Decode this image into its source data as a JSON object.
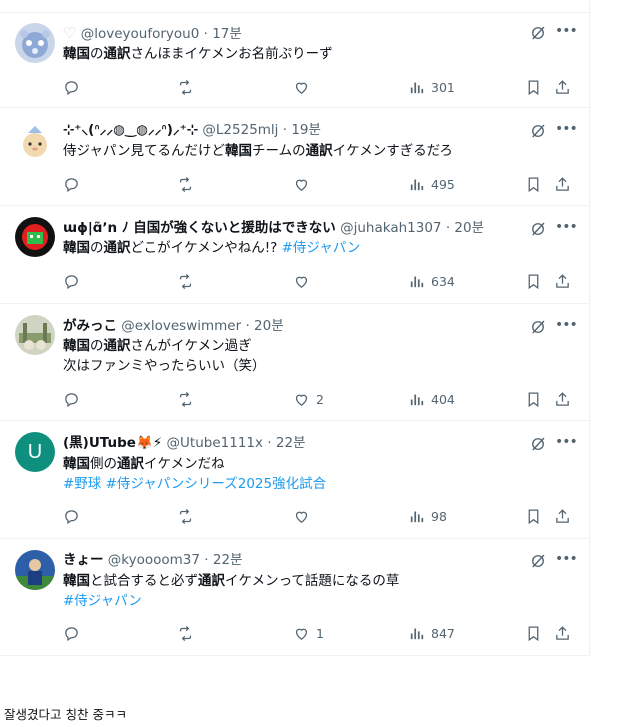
{
  "tweets": [
    {
      "heart_prefix": "♡",
      "display_name": "",
      "handle": "@loveyouforyou0",
      "time": "17분",
      "lines": [
        [
          {
            "t": "韓国",
            "b": true
          },
          {
            "t": "の"
          },
          {
            "t": "通訳",
            "b": true
          },
          {
            "t": "さんほまイケメンお名前ぷりーず"
          }
        ]
      ],
      "likes": "",
      "views": "301"
    },
    {
      "display_name": "⊹⁺⸜(ᐢ⸝⸝◍‿◍⸝⸝ᐢ)⸝⁺⊹",
      "handle": "@L2525mlj",
      "time": "19분",
      "lines": [
        [
          {
            "t": "侍ジャパン見てるんだけど"
          },
          {
            "t": "韓国",
            "b": true
          },
          {
            "t": "チームの"
          },
          {
            "t": "通訳",
            "b": true
          },
          {
            "t": "イケメンすぎるだろ"
          }
        ]
      ],
      "likes": "",
      "views": "495"
    },
    {
      "display_name": "ɯɸ|ɑ̃ʼn ﾉ 自国が強くないと援助はできない",
      "handle": "@juhakah1307",
      "time": "20분",
      "lines": [
        [
          {
            "t": "韓国",
            "b": true
          },
          {
            "t": "の"
          },
          {
            "t": "通訳",
            "b": true
          },
          {
            "t": "どこがイケメンやねん!? "
          },
          {
            "t": "#侍ジャパン",
            "h": true
          }
        ]
      ],
      "likes": "",
      "views": "634"
    },
    {
      "display_name": "がみっこ",
      "handle": "@exloveswimmer",
      "time": "20분",
      "lines": [
        [
          {
            "t": "韓国",
            "b": true
          },
          {
            "t": "の"
          },
          {
            "t": "通訳",
            "b": true
          },
          {
            "t": "さんがイケメン過ぎ"
          }
        ],
        [
          {
            "t": "次はファンミやったらいい（笑）"
          }
        ]
      ],
      "likes": "2",
      "views": "404"
    },
    {
      "display_name": "(黒)UTube🦊⚡",
      "handle": "@Utube1111x",
      "time": "22분",
      "avatar_letter": "U",
      "lines": [
        [
          {
            "t": "韓国",
            "b": true
          },
          {
            "t": "側の"
          },
          {
            "t": "通訳",
            "b": true
          },
          {
            "t": "イケメンだね"
          }
        ],
        [
          {
            "t": "#野球",
            "h": true
          },
          {
            "t": " "
          },
          {
            "t": "#侍ジャパンシリーズ2025強化試合",
            "h": true
          }
        ]
      ],
      "likes": "",
      "views": "98"
    },
    {
      "display_name": "きょー",
      "handle": "@kyoooom37",
      "time": "22분",
      "lines": [
        [
          {
            "t": "韓国",
            "b": true
          },
          {
            "t": "と試合すると必ず"
          },
          {
            "t": "通訳",
            "b": true
          },
          {
            "t": "イケメンって話題になるの草"
          }
        ],
        [
          {
            "t": "#侍ジャパン",
            "h": true
          }
        ]
      ],
      "likes": "1",
      "views": "847"
    }
  ],
  "caption": "잘생겼다고 칭찬 중ㅋㅋ",
  "colors": {
    "text": "#0f1419",
    "secondary": "#536471",
    "link": "#1d9bf0",
    "border": "#eff3f4"
  },
  "icons": [
    "reply-icon",
    "retweet-icon",
    "like-icon",
    "views-icon",
    "bookmark-icon",
    "share-icon",
    "grok-icon",
    "more-icon"
  ]
}
